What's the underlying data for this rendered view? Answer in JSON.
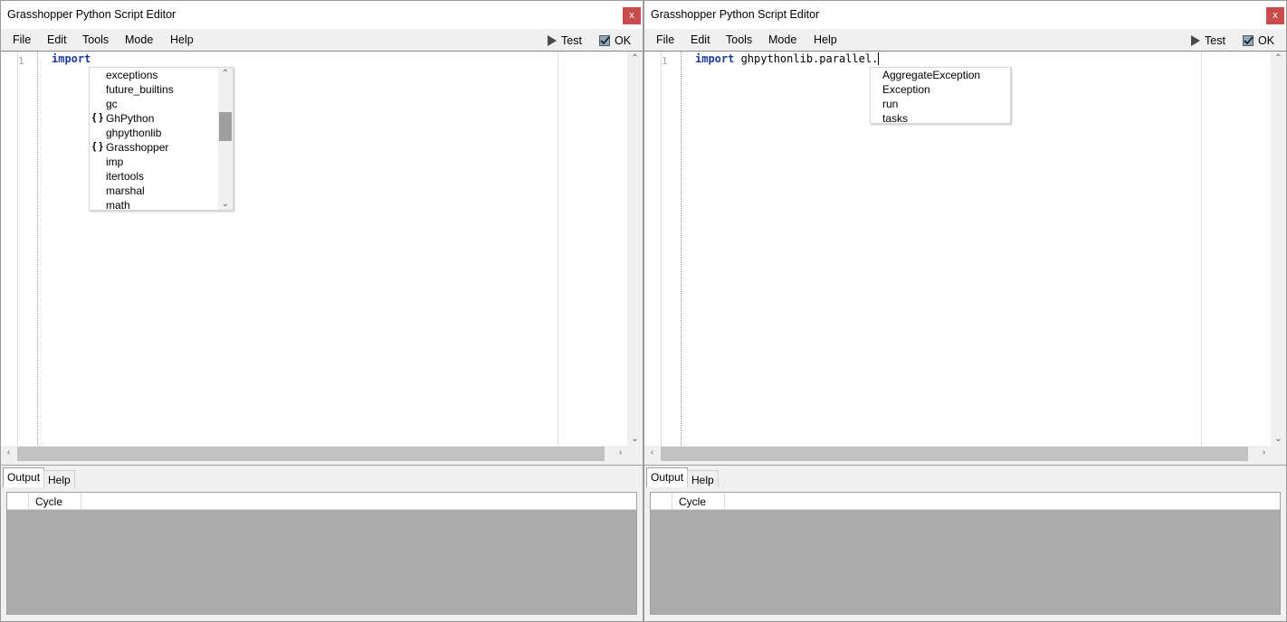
{
  "windows": [
    {
      "title": "Grasshopper Python Script Editor",
      "close_label": "x",
      "menu": [
        "File",
        "Edit",
        "Tools",
        "Mode",
        "Help"
      ],
      "test_label": "Test",
      "ok_label": "OK",
      "line_number": "1",
      "code_keyword": "import",
      "code_rest": "",
      "autocomplete": [
        {
          "label": "exceptions",
          "namespace": ""
        },
        {
          "label": "future_builtins",
          "namespace": ""
        },
        {
          "label": "gc",
          "namespace": ""
        },
        {
          "label": "GhPython",
          "namespace": "{ }"
        },
        {
          "label": "ghpythonlib",
          "namespace": ""
        },
        {
          "label": "Grasshopper",
          "namespace": "{ }"
        },
        {
          "label": "imp",
          "namespace": ""
        },
        {
          "label": "itertools",
          "namespace": ""
        },
        {
          "label": "marshal",
          "namespace": ""
        },
        {
          "label": "math",
          "namespace": ""
        }
      ],
      "tabs": [
        "Output",
        "Help"
      ],
      "grid_column": "Cycle"
    },
    {
      "title": "Grasshopper Python Script Editor",
      "close_label": "x",
      "menu": [
        "File",
        "Edit",
        "Tools",
        "Mode",
        "Help"
      ],
      "test_label": "Test",
      "ok_label": "OK",
      "line_number": "1",
      "code_keyword": "import",
      "code_rest": " ghpythonlib.parallel.",
      "autocomplete": [
        {
          "label": "AggregateException",
          "namespace": ""
        },
        {
          "label": "Exception",
          "namespace": ""
        },
        {
          "label": "run",
          "namespace": ""
        },
        {
          "label": "tasks",
          "namespace": ""
        }
      ],
      "tabs": [
        "Output",
        "Help"
      ],
      "grid_column": "Cycle"
    }
  ]
}
